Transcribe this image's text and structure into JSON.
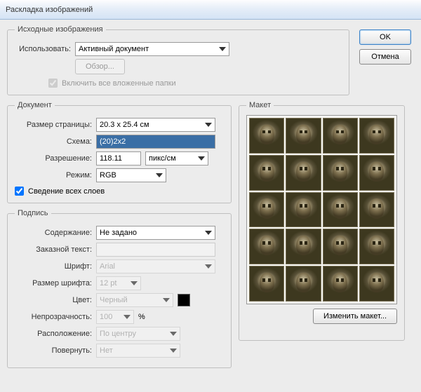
{
  "window": {
    "title": "Раскладка изображений"
  },
  "buttons": {
    "ok": "OK",
    "cancel": "Отмена",
    "browse": "Обзор...",
    "change_layout": "Изменить макет..."
  },
  "source": {
    "legend": "Исходные изображения",
    "use_label": "Использовать:",
    "use_value": "Активный документ",
    "include_subfolders": "Включить все вложенные папки"
  },
  "document": {
    "legend": "Документ",
    "page_size_label": "Размер страницы:",
    "page_size_value": "20.3 x 25.4 см",
    "schema_label": "Схема:",
    "schema_value": "(20)2x2",
    "resolution_label": "Разрешение:",
    "resolution_value": "118.11",
    "resolution_units": "пикс/см",
    "mode_label": "Режим:",
    "mode_value": "RGB",
    "flatten": "Сведение всех слоев"
  },
  "caption": {
    "legend": "Подпись",
    "content_label": "Содержание:",
    "content_value": "Не задано",
    "custom_text_label": "Заказной текст:",
    "custom_text_value": "",
    "font_label": "Шрифт:",
    "font_value": "Arial",
    "font_size_label": "Размер шрифта:",
    "font_size_value": "12 pt",
    "color_label": "Цвет:",
    "color_value": "Черный",
    "opacity_label": "Непрозрачность:",
    "opacity_value": "100",
    "opacity_suffix": "%",
    "position_label": "Расположение:",
    "position_value": "По центру",
    "rotate_label": "Повернуть:",
    "rotate_value": "Нет"
  },
  "layout": {
    "legend": "Макет"
  }
}
